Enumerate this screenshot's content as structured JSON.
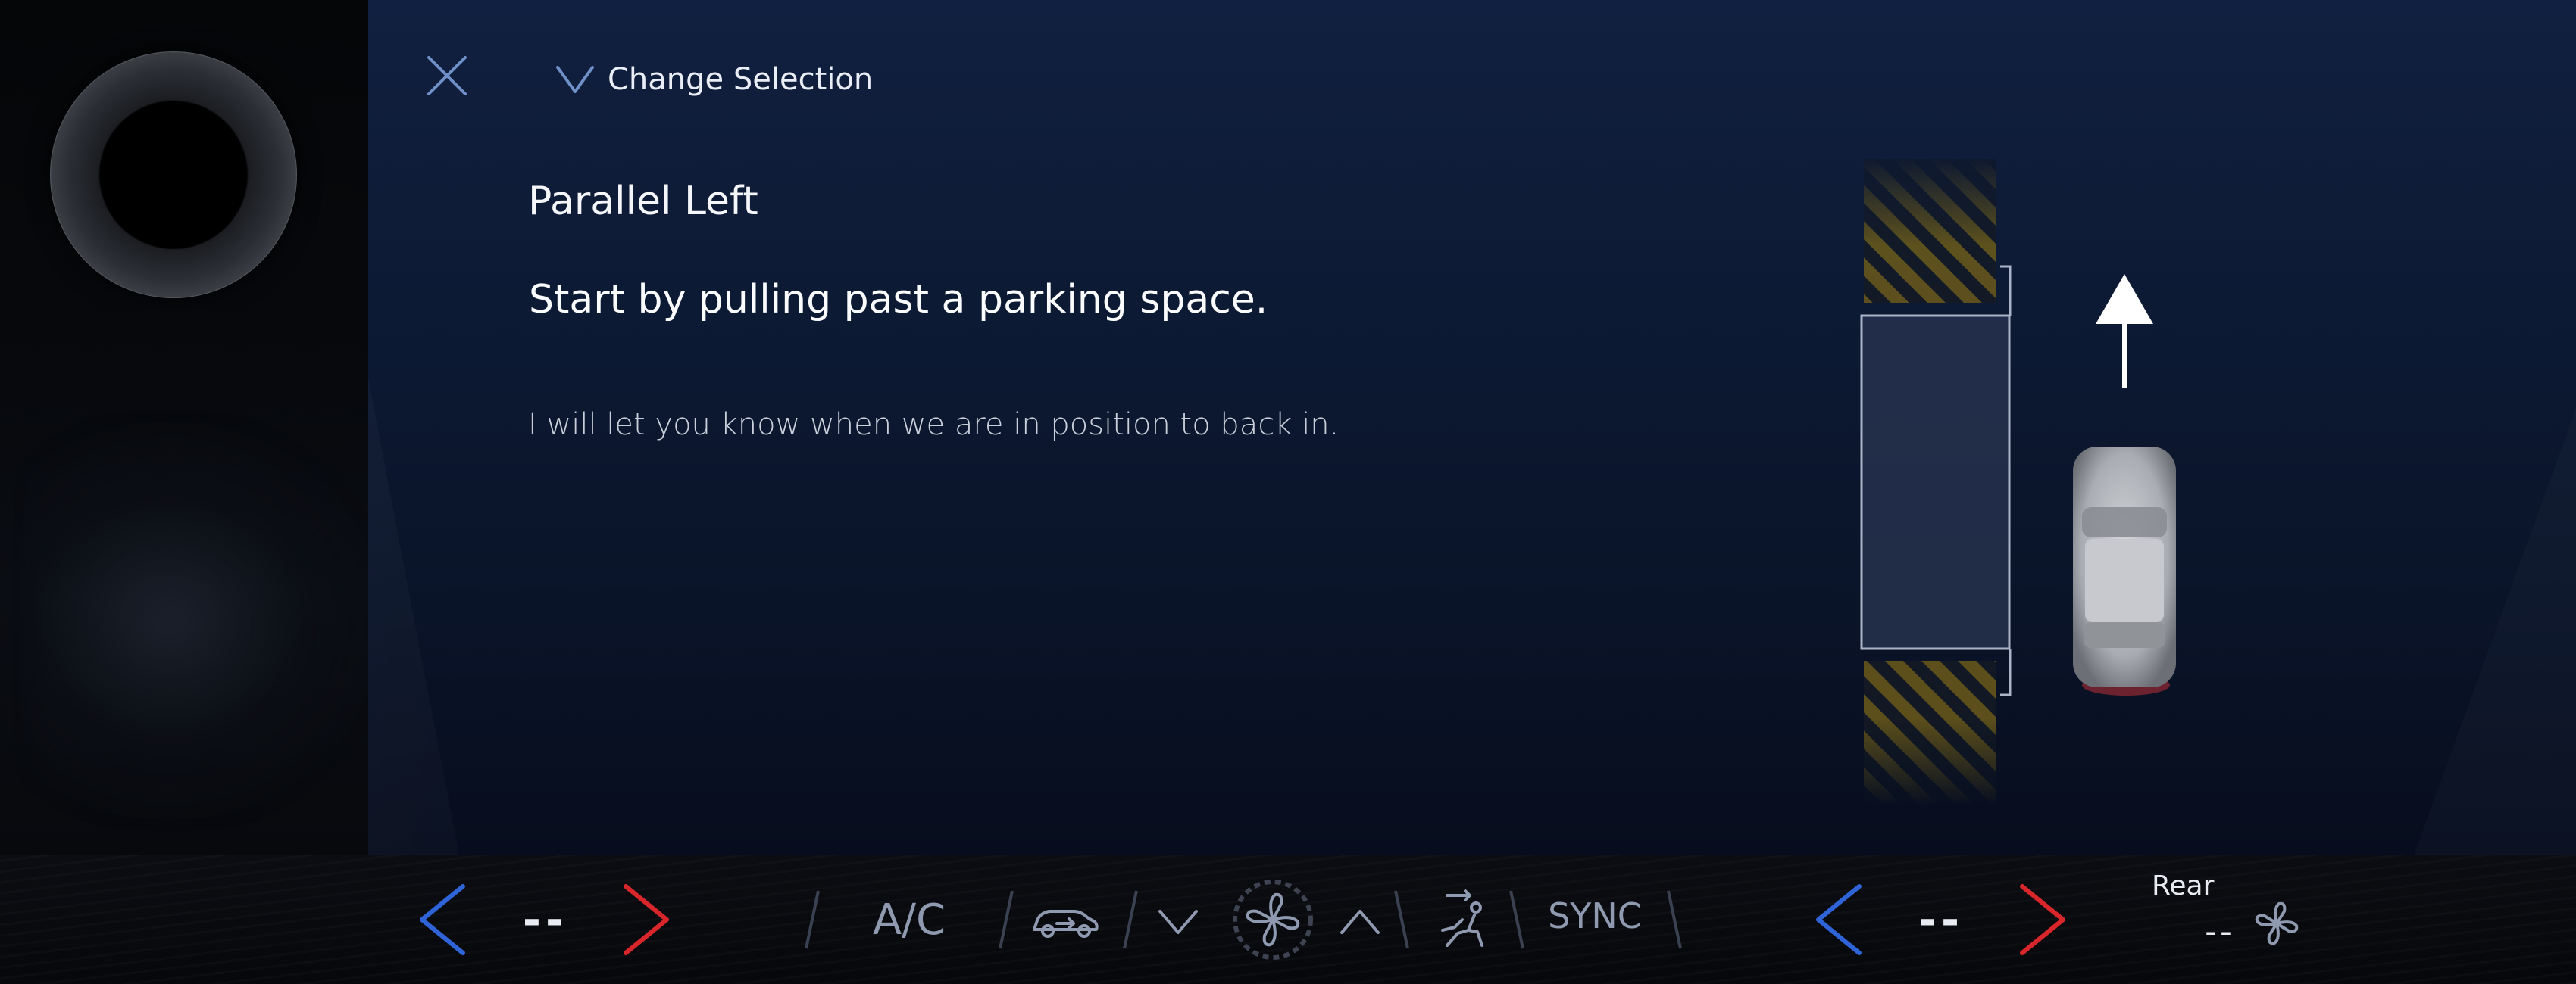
{
  "header": {
    "change_selection_label": "Change Selection"
  },
  "content": {
    "title": "Parallel Left",
    "instruction": "Start by pulling past a parking space.",
    "subtext": "I will let you know when we are in position to back in."
  },
  "climate": {
    "driver_temp": "--",
    "ac_label": "A/C",
    "sync_label": "SYNC",
    "passenger_temp": "--",
    "rear_label": "Rear",
    "rear_fan_value": "--"
  },
  "colors": {
    "decrease_arrow": "#2f64d8",
    "increase_arrow": "#d8262b",
    "icon_muted": "#8f99b0",
    "hazard_stripe": "#6b5a1a"
  },
  "icons": [
    "close-icon",
    "chevron-down-icon",
    "recirculation-icon",
    "fan-icon",
    "seat-airflow-icon",
    "parking-hatch-icon",
    "forward-arrow-icon",
    "vehicle-icon"
  ]
}
